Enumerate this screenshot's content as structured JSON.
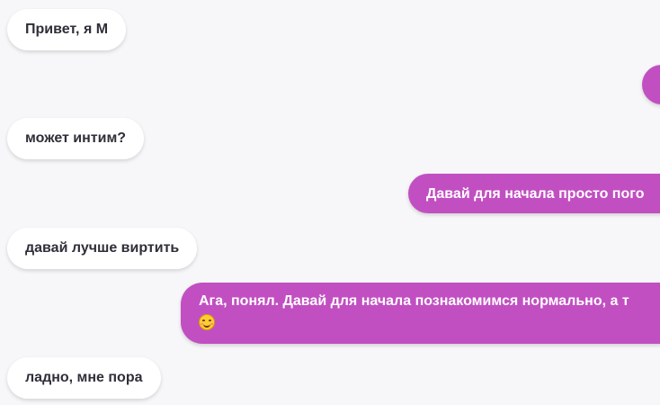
{
  "messages": [
    {
      "direction": "incoming",
      "text": "Привет, я М"
    },
    {
      "direction": "outgoing",
      "text": ""
    },
    {
      "direction": "incoming",
      "text": "может интим?"
    },
    {
      "direction": "outgoing",
      "text": "Давай для начала просто пого"
    },
    {
      "direction": "incoming",
      "text": "давай лучше виртить"
    },
    {
      "direction": "outgoing",
      "text": "Ага, понял. Давай для начала познакомимся нормально, а т",
      "emoji": "smiling-face-icon"
    },
    {
      "direction": "incoming",
      "text": "ладно, мне пора"
    }
  ],
  "colors": {
    "background": "#f7f7f9",
    "incoming_bubble": "#ffffff",
    "incoming_text": "#2f2f3a",
    "outgoing_bubble": "#c24fc2",
    "outgoing_text": "#ffffff"
  }
}
